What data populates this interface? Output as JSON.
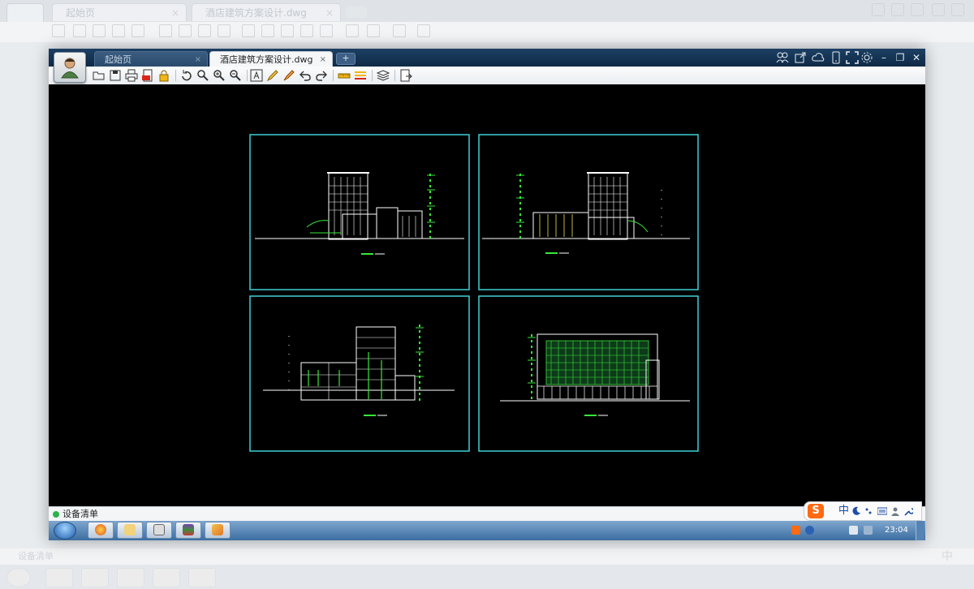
{
  "background": {
    "tabs": [
      "起始页",
      "酒店建筑方案设计.dwg"
    ],
    "status_text": "设备清单",
    "ime_char": "中"
  },
  "app": {
    "tabs": [
      {
        "label": "起始页",
        "active": false
      },
      {
        "label": "酒店建筑方案设计.dwg",
        "active": true
      }
    ],
    "add_tab": "+",
    "window_controls": {
      "minimize": "–",
      "restore": "❐",
      "close": "✕"
    },
    "toolbar": [
      "open-icon",
      "save-icon",
      "print-icon",
      "pdf-export-icon",
      "lock-icon",
      "rotate-icon",
      "zoom-window-icon",
      "zoom-in-icon",
      "zoom-out-icon",
      "text-icon",
      "pencil-icon",
      "highlighter-icon",
      "undo-icon",
      "redo-icon",
      "measure-icon",
      "dimension-icon",
      "layers-icon",
      "export-icon"
    ],
    "title_icons": [
      "users-icon",
      "share-icon",
      "cloud-icon",
      "phone-icon",
      "fullscreen-icon",
      "settings-icon"
    ]
  },
  "status": {
    "text": "设备清单"
  },
  "ime": {
    "logo": "S",
    "label": "中"
  },
  "taskbar": {
    "apps": [
      "browser-icon",
      "folder-icon",
      "user-icon",
      "archive-icon",
      "image-viewer-icon"
    ],
    "tray": [
      "sogou-icon",
      "help-icon",
      "network-icon",
      "signal-icon"
    ],
    "clock": "23:04"
  },
  "colors": {
    "viewport_frame": "#3fd0d6",
    "drawing_white": "#ffffff",
    "drawing_green": "#39e639",
    "drawing_yellow": "#f2e14a",
    "background": "#000000"
  }
}
